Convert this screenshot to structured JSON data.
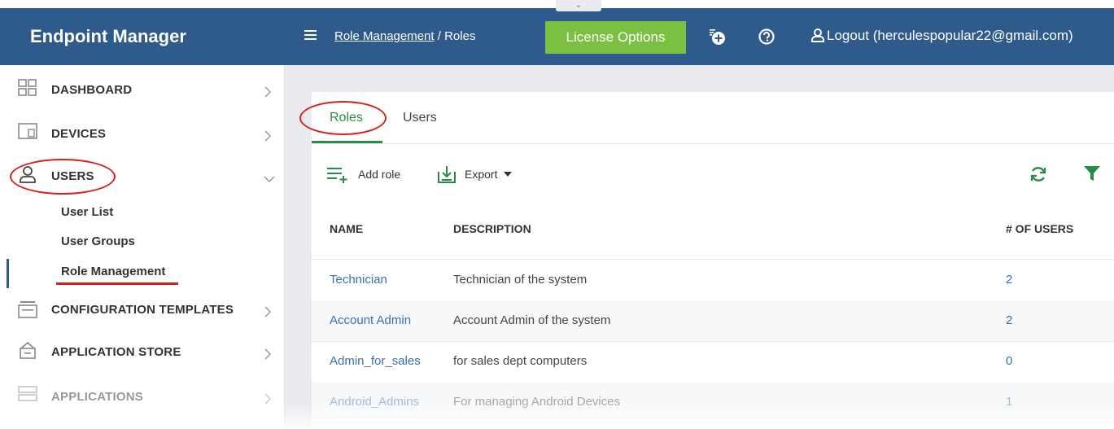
{
  "app": {
    "title": "Endpoint Manager"
  },
  "topbar": {
    "breadcrumb_link": "Role Management",
    "breadcrumb_sep": " / ",
    "breadcrumb_current": "Roles",
    "license_button": "License Options",
    "collapse_glyph": "⌄",
    "logout_label": "Logout (herculespopular22@gmail.com)",
    "colors": {
      "bar": "#2f5a8c",
      "license": "#7cc043"
    }
  },
  "sidebar": {
    "items": [
      {
        "label": "DASHBOARD",
        "icon": "dashboard-grid-icon"
      },
      {
        "label": "DEVICES",
        "icon": "devices-icon"
      },
      {
        "label": "USERS",
        "icon": "user-icon"
      },
      {
        "label": "CONFIGURATION TEMPLATES",
        "icon": "templates-icon"
      },
      {
        "label": "APPLICATION STORE",
        "icon": "store-basket-icon"
      },
      {
        "label": "APPLICATIONS",
        "icon": "applications-icon"
      }
    ],
    "sub_items": [
      "User List",
      "User Groups",
      "Role Management"
    ]
  },
  "tabs": [
    "Roles",
    "Users"
  ],
  "toolbar": {
    "add_role": "Add role",
    "export": "Export"
  },
  "table": {
    "headers": [
      "NAME",
      "DESCRIPTION",
      "# OF USERS"
    ],
    "rows": [
      {
        "name": "Technician",
        "description": "Technician of the system",
        "users": "2"
      },
      {
        "name": "Account Admin",
        "description": "Account Admin of the system",
        "users": "2"
      },
      {
        "name": "Admin_for_sales",
        "description": "for sales dept computers",
        "users": "0"
      },
      {
        "name": "Android_Admins",
        "description": "For managing Android Devices",
        "users": "1"
      }
    ]
  },
  "accent_colors": {
    "link": "#3a70b0",
    "active_tab": "#2b8a4a",
    "annotation": "#d81e1e"
  }
}
